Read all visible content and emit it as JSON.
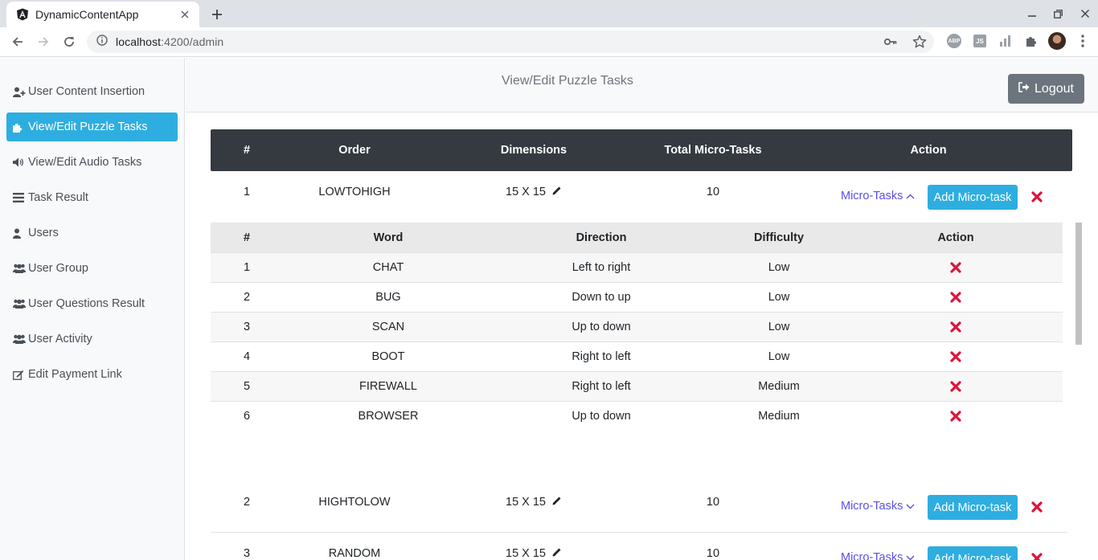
{
  "browser": {
    "tab_title": "DynamicContentApp",
    "url_host": "localhost",
    "url_rest": ":4200/admin",
    "extensions": [
      "ABP",
      "JS"
    ]
  },
  "sidebar": {
    "items": [
      {
        "label": "User Content Insertion",
        "icon": "user-plus-icon"
      },
      {
        "label": "View/Edit Puzzle Tasks",
        "icon": "puzzle-icon",
        "active": true
      },
      {
        "label": "View/Edit Audio Tasks",
        "icon": "volume-icon"
      },
      {
        "label": "Task Result",
        "icon": "list-icon"
      },
      {
        "label": "Users",
        "icon": "user-icon"
      },
      {
        "label": "User Group",
        "icon": "users-icon"
      },
      {
        "label": "User Questions Result",
        "icon": "users-icon"
      },
      {
        "label": "User Activity",
        "icon": "users-icon"
      },
      {
        "label": "Edit Payment Link",
        "icon": "edit-icon"
      }
    ]
  },
  "header": {
    "title": "View/Edit Puzzle Tasks",
    "logout_label": "Logout"
  },
  "table": {
    "columns": [
      "#",
      "Order",
      "Dimensions",
      "Total Micro-Tasks",
      "Action"
    ],
    "micro_tasks_label": "Micro-Tasks",
    "add_label": "Add Micro-task",
    "rows": [
      {
        "num": "1",
        "order": "LOWTOHIGH",
        "dimensions": "15 X 15",
        "total": "10",
        "expanded": true
      },
      {
        "num": "2",
        "order": "HIGHTOLOW",
        "dimensions": "15 X 15",
        "total": "10",
        "expanded": false
      },
      {
        "num": "3",
        "order": "RANDOM",
        "dimensions": "15 X 15",
        "total": "10",
        "expanded": false
      }
    ]
  },
  "micro_table": {
    "columns": [
      "#",
      "Word",
      "Direction",
      "Difficulty",
      "Action"
    ],
    "rows": [
      {
        "num": "1",
        "word": "CHAT",
        "direction": "Left to right",
        "difficulty": "Low"
      },
      {
        "num": "2",
        "word": "BUG",
        "direction": "Down to up",
        "difficulty": "Low"
      },
      {
        "num": "3",
        "word": "SCAN",
        "direction": "Up to down",
        "difficulty": "Low"
      },
      {
        "num": "4",
        "word": "BOOT",
        "direction": "Right to left",
        "difficulty": "Low"
      },
      {
        "num": "5",
        "word": "FIREWALL",
        "direction": "Right to left",
        "difficulty": "Medium"
      },
      {
        "num": "6",
        "word": "BROWSER",
        "direction": "Up to down",
        "difficulty": "Medium"
      }
    ]
  },
  "colors": {
    "accent": "#2eaee0",
    "header_dark": "#343a40",
    "logout": "#6c757d",
    "link": "#5a4fe8",
    "delete": "#dc143c"
  }
}
